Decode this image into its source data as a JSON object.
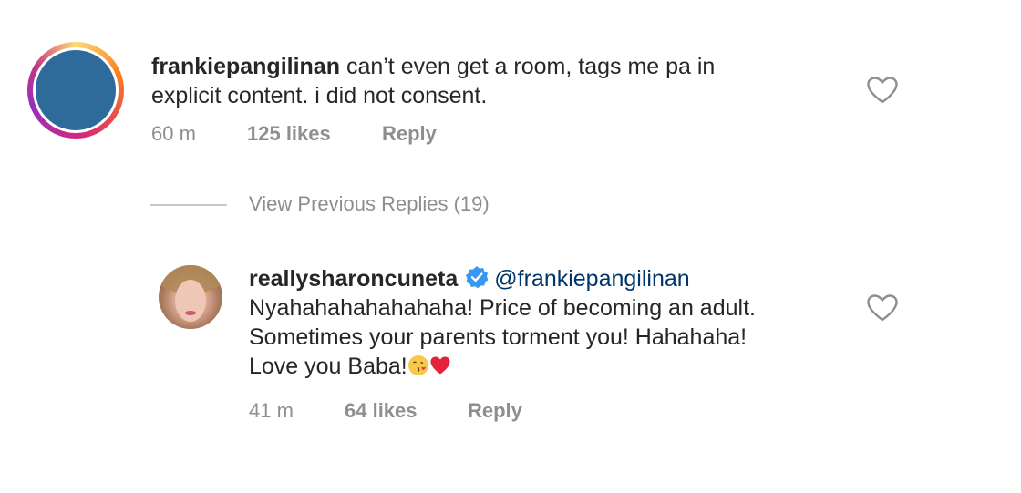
{
  "comment": {
    "username": "frankiepangilinan",
    "text_line1": "can’t even get a room, tags me pa in",
    "text_line2": "explicit content. i did not consent.",
    "time": "60 m",
    "likes": "125 likes",
    "reply_label": "Reply",
    "heart_icon": "heart-outline-icon"
  },
  "view_previous_replies": "View Previous Replies (19)",
  "reply": {
    "username": "reallysharoncuneta",
    "verified_icon": "verified-badge-icon",
    "mention": "@frankiepangilinan",
    "text_line1": "Nyahahahahahahaha! Price of becoming an adult.",
    "text_line2": "Sometimes your parents torment you! Hahahaha!",
    "text_line3": "Love you Baba!",
    "emojis": [
      "kissing-face-emoji",
      "red-heart-emoji"
    ],
    "time": "41 m",
    "likes": "64 likes",
    "reply_label": "Reply",
    "heart_icon": "heart-outline-icon"
  },
  "colors": {
    "text": "#262626",
    "meta": "#8e8e8e",
    "mention": "#003569",
    "verified": "#3897f0",
    "avatar_fill": "#2f6b9a"
  }
}
